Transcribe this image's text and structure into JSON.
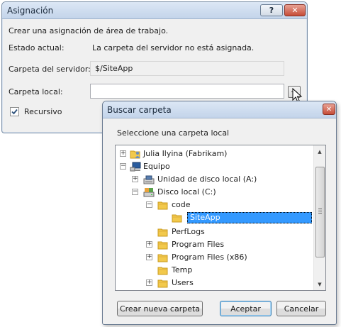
{
  "assign": {
    "title": "Asignación",
    "help": "?",
    "close": "✕",
    "intro": "Crear una asignación de área de trabajo.",
    "status_label": "Estado actual:",
    "status_value": "La carpeta del servidor no está asignada.",
    "server_label": "Carpeta del servidor:",
    "server_value": "$/SiteApp",
    "local_label": "Carpeta local:",
    "local_value": "",
    "browse_label": "...",
    "recursive_label": "Recursivo",
    "recursive_checked": true
  },
  "browse": {
    "title": "Buscar carpeta",
    "close": "✕",
    "prompt": "Seleccione una carpeta local",
    "tree": [
      {
        "label": "Julia Ilyina (Fabrikam)",
        "expander": "+",
        "icon": "user-folder-icon"
      },
      {
        "label": "Equipo",
        "expander": "−",
        "icon": "computer-icon"
      },
      {
        "label": "Unidad de disco local (A:)",
        "expander": "+",
        "icon": "floppy-drive-icon"
      },
      {
        "label": "Disco local (C:)",
        "expander": "−",
        "icon": "hard-drive-icon"
      },
      {
        "label": "code",
        "expander": "−",
        "icon": "folder-icon"
      },
      {
        "label": "SiteApp",
        "expander": "",
        "icon": "folder-icon",
        "selected": true
      },
      {
        "label": "PerfLogs",
        "expander": "",
        "icon": "folder-icon"
      },
      {
        "label": "Program Files",
        "expander": "+",
        "icon": "folder-icon"
      },
      {
        "label": "Program Files (x86)",
        "expander": "+",
        "icon": "folder-icon"
      },
      {
        "label": "Temp",
        "expander": "",
        "icon": "folder-icon"
      },
      {
        "label": "Users",
        "expander": "+",
        "icon": "folder-icon"
      }
    ],
    "new_folder": "Crear nueva carpeta",
    "ok": "Aceptar",
    "cancel": "Cancelar"
  }
}
